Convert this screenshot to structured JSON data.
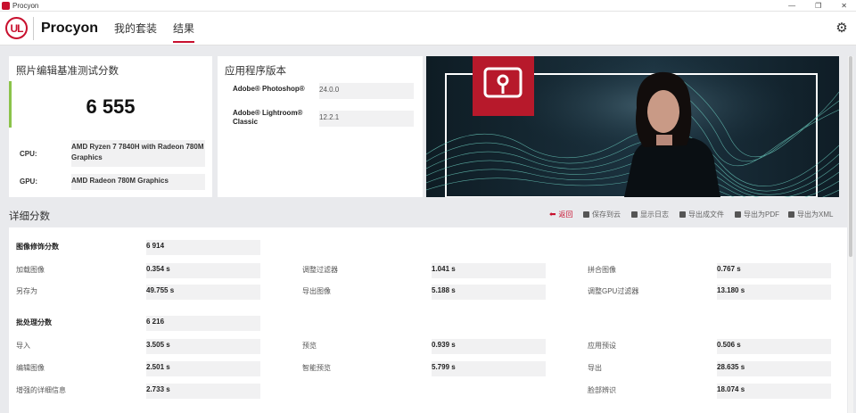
{
  "window": {
    "title": "Procyon",
    "min": "—",
    "restore": "❐",
    "close": "✕"
  },
  "header": {
    "logo": "UL",
    "brand": "Procyon",
    "tabs": [
      {
        "label": "我的套装"
      },
      {
        "label": "结果"
      }
    ],
    "settings_icon": "gear-icon"
  },
  "score": {
    "title": "照片编辑基准测试分数",
    "value": "6 555",
    "cpu_label": "CPU:",
    "cpu_value": "AMD Ryzen 7 7840H with Radeon 780M Graphics",
    "gpu_label": "GPU:",
    "gpu_value": "AMD Radeon 780M Graphics"
  },
  "apps": {
    "title": "应用程序版本",
    "items": [
      {
        "name": "Adobe® Photoshop®",
        "version": "24.0.0"
      },
      {
        "name": "Adobe® Lightroom® Classic",
        "version": "12.2.1"
      }
    ]
  },
  "details": {
    "title": "详细分数",
    "actions": [
      "返回",
      "保存到云",
      "显示日志",
      "导出成文件",
      "导出为PDF",
      "导出为XML"
    ],
    "groups": [
      {
        "name": "图像修饰分数",
        "score": "6 914",
        "items": [
          {
            "name": "加载图像",
            "value": "0.354 s"
          },
          {
            "name": "调整过滤器",
            "value": "1.041 s"
          },
          {
            "name": "拼合图像",
            "value": "0.767 s"
          },
          {
            "name": "另存为",
            "value": "49.755 s"
          },
          {
            "name": "导出图像",
            "value": "5.188 s"
          },
          {
            "name": "调整GPU过滤器",
            "value": "13.180 s"
          }
        ]
      },
      {
        "name": "批处理分数",
        "score": "6 216",
        "items": [
          {
            "name": "导入",
            "value": "3.505 s"
          },
          {
            "name": "预览",
            "value": "0.939 s"
          },
          {
            "name": "应用预设",
            "value": "0.506 s"
          },
          {
            "name": "编辑图像",
            "value": "2.501 s"
          },
          {
            "name": "智能预览",
            "value": "5.799 s"
          },
          {
            "name": "导出",
            "value": "28.635 s"
          },
          {
            "name": "增强的详细信息",
            "value": "2.733 s"
          },
          {
            "name": "脸部辨识",
            "value": "18.074 s"
          }
        ]
      }
    ]
  },
  "colors": {
    "accent": "#c8102e",
    "score_bar": "#8bc34a"
  }
}
